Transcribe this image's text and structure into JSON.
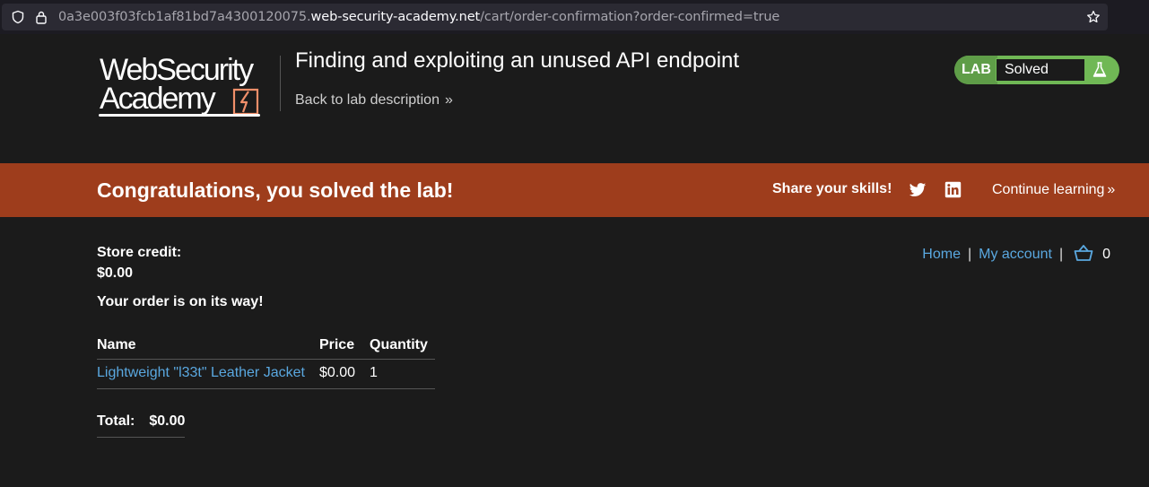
{
  "browser": {
    "url_prefix": "0a3e003f03fcb1af81bd7a4300120075.",
    "url_host": "web-security-academy.net",
    "url_path": "/cart/order-confirmation?order-confirmed=true",
    "icons": {
      "shield": "shield-icon",
      "lock": "lock-icon",
      "star": "star-icon"
    }
  },
  "header": {
    "logo_line1": "WebSecurity",
    "logo_line2": "Academy",
    "lab_title": "Finding and exploiting an unused API endpoint",
    "back_link": "Back to lab description",
    "back_chevron": "»",
    "lab_badge": "LAB",
    "lab_status": "Solved",
    "colors": {
      "status_green": "#70b855",
      "status_dark_green": "#5f9d48"
    }
  },
  "banner": {
    "title": "Congratulations, you solved the lab!",
    "share_label": "Share your skills!",
    "continue_label": "Continue learning",
    "continue_chevron": "»",
    "color": "#9e3d1c"
  },
  "nav": {
    "home": "Home",
    "separator": "|",
    "my_account": "My account",
    "cart_count": "0"
  },
  "account": {
    "store_credit_label": "Store credit:",
    "store_credit_value": "$0.00",
    "order_message": "Your order is on its way!"
  },
  "order": {
    "columns": [
      "Name",
      "Price",
      "Quantity"
    ],
    "rows": [
      {
        "name": "Lightweight \"l33t\" Leather Jacket",
        "price": "$0.00",
        "quantity": "1"
      }
    ],
    "total_label": "Total:",
    "total_value": "$0.00"
  }
}
